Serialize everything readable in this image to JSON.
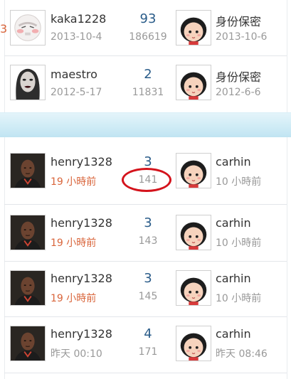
{
  "threads": [
    {
      "author": "kaka1228",
      "author_date": "2013-10-4",
      "author_avatar": "cartoon-face-icon",
      "replies": "93",
      "views": "186619",
      "last_poster": "身份保密",
      "last_date": "2013-10-6",
      "last_avatar": "default-girl-avatar-icon",
      "left_fragment": "3"
    },
    {
      "author": "maestro",
      "author_date": "2012-5-17",
      "author_avatar": "woman-portrait-avatar",
      "replies": "2",
      "views": "11831",
      "last_poster": "身份保密",
      "last_date": "2012-6-6",
      "last_avatar": "default-girl-avatar-icon"
    },
    {
      "author": "henry1328",
      "author_date": "19 小時前",
      "author_avatar": "man-portrait-avatar",
      "replies": "3",
      "views": "141",
      "last_poster": "carhin",
      "last_date": "10 小時前",
      "last_avatar": "default-girl-avatar-icon"
    },
    {
      "author": "henry1328",
      "author_date": "19 小時前",
      "author_avatar": "man-portrait-avatar",
      "replies": "3",
      "views": "143",
      "last_poster": "carhin",
      "last_date": "10 小時前",
      "last_avatar": "default-girl-avatar-icon"
    },
    {
      "author": "henry1328",
      "author_date": "19 小時前",
      "author_avatar": "man-portrait-avatar",
      "replies": "3",
      "views": "145",
      "last_poster": "carhin",
      "last_date": "10 小時前",
      "last_avatar": "default-girl-avatar-icon"
    },
    {
      "author": "henry1328",
      "author_date": "昨天 00:10",
      "author_avatar": "man-portrait-avatar",
      "replies": "4",
      "views": "171",
      "last_poster": "carhin",
      "last_date": "昨天 08:46",
      "last_avatar": "default-girl-avatar-icon"
    }
  ],
  "colors": {
    "recent_date": "#d9653b",
    "replies": "#2a5c89",
    "annotation_circle": "#d4131c"
  },
  "annotation": {
    "shape": "red-ellipse",
    "target": "threads.2.views"
  }
}
